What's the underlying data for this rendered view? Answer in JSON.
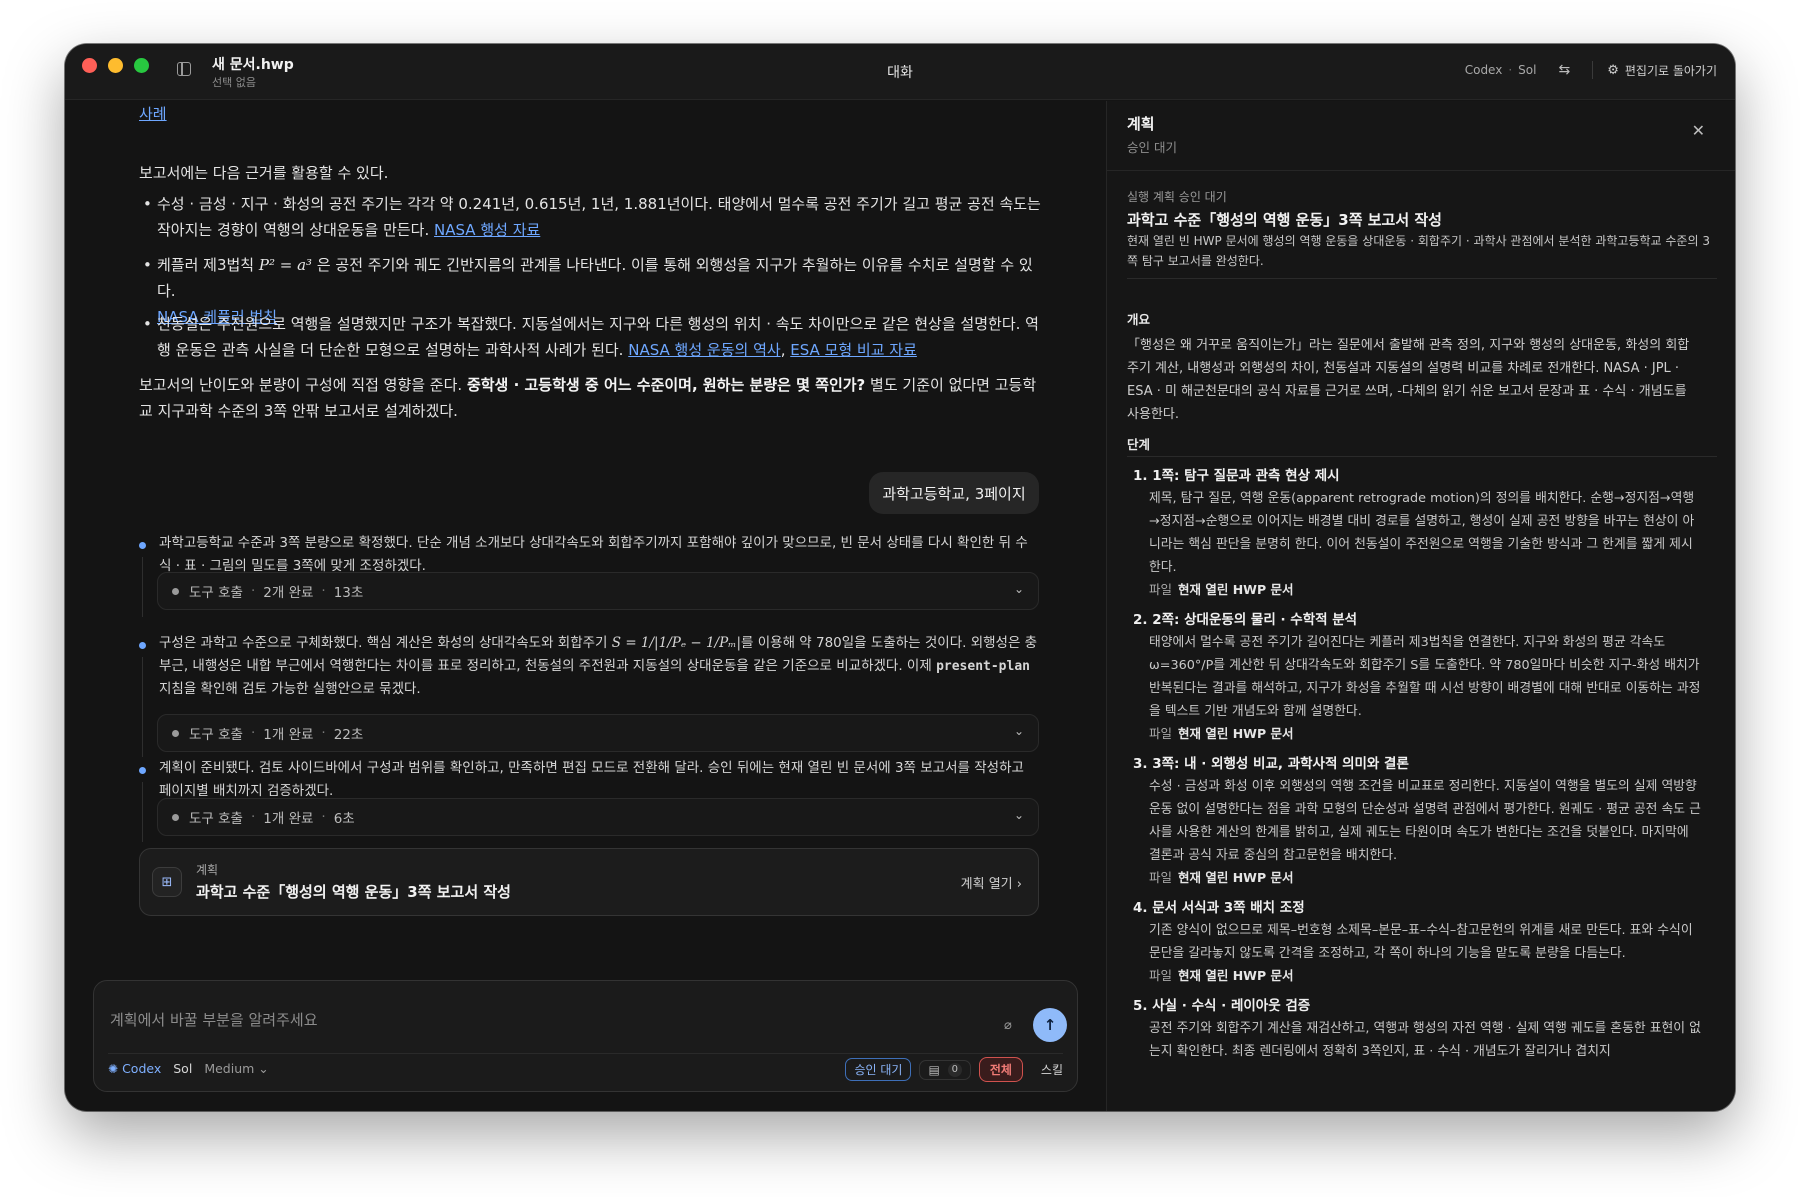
{
  "titlebar": {
    "doc_title": "새 문서.hwp",
    "doc_sub": "선택 없음",
    "center": "대화",
    "agent": "Codex",
    "model": "Sol",
    "back_label": "편집기로 돌아가기"
  },
  "chat": {
    "top_link": "사례",
    "intro": "보고서에는 다음 근거를 활용할 수 있다.",
    "bullets": {
      "b1_text": "수성 · 금성 · 지구 · 화성의 공전 주기는 각각 약 0.241년, 0.615년, 1년, 1.881년이다. 태양에서 멀수록 공전 주기가 길고 평균 공전 속도는 작아지는 경향이 역행의 상대운동을 만든다. ",
      "b1_link": "NASA 행성 자료",
      "b2_pre": "케플러 제3법칙 ",
      "b2_math": "P² = a³",
      "b2_post": " 은 공전 주기와 궤도 긴반지름의 관계를 나타낸다. 이를 통해 외행성을 지구가 추월하는 이유를 수치로 설명할 수 있다.",
      "b2_link": "NASA 케플러 법칙",
      "b3_text": "천동설은 주전원으로 역행을 설명했지만 구조가 복잡했다. 지동설에서는 지구와 다른 행성의 위치 · 속도 차이만으로 같은 현상을 설명한다. 역행 운동은 관측 사실을 더 단순한 모형으로 설명하는 과학사적 사례가 된다. ",
      "b3_link1": "NASA 행성 운동의 역사",
      "b3_sep": ", ",
      "b3_link2": "ESA 모형 비교 자료"
    },
    "closing_pre": "보고서의 난이도와 분량이 구성에 직접 영향을 준다. ",
    "closing_bold": "중학생 · 고등학생 중 어느 수준이며, 원하는 분량은 몇 쪽인가?",
    "closing_post": " 별도 기준이 없다면 고등학교 지구과학 수준의 3쪽 안팎 보고서로 설계하겠다.",
    "user_message": "과학고등학교, 3페이지",
    "steps": [
      {
        "text": "과학고등학교 수준과 3쪽 분량으로 확정했다. 단순 개념 소개보다 상대각속도와 회합주기까지 포함해야 깊이가 맞으므로, 빈 문서 상태를 다시 확인한 뒤 수식 · 표 · 그림의 밀도를 3쪽에 맞게 조정하겠다.",
        "tool": "도구 호출",
        "done": "2개 완료",
        "time": "13초"
      },
      {
        "text_pre": "구성은 과학고 수준으로 구체화했다. 핵심 계산은 화성의 상대각속도와 회합주기 ",
        "math": "S = 1/|1/Pₑ − 1/Pₘ|",
        "text_mid": "를 이용해 약 780일을 도출하는 것이다. 외행성은 충 부근, 내행성은 내합 부근에서 역행한다는 차이를 표로 정리하고, 천동설의 주전원과 지동설의 상대운동을 같은 기준으로 비교하겠다. 이제 ",
        "code": "present-plan",
        "text_post": " 지침을 확인해 검토 가능한 실행안으로 묶겠다.",
        "tool": "도구 호출",
        "done": "1개 완료",
        "time": "22초"
      },
      {
        "text": "계획이 준비됐다. 검토 사이드바에서 구성과 범위를 확인하고, 만족하면 편집 모드로 전환해 달라. 승인 뒤에는 현재 열린 빈 문서에 3쪽 보고서를 작성하고 페이지별 배치까지 검증하겠다.",
        "tool": "도구 호출",
        "done": "1개 완료",
        "time": "6초"
      }
    ],
    "plan_card": {
      "label": "계획",
      "title": "과학고 수준「행성의 역행 운동」3쪽 보고서 작성",
      "open": "계획 열기"
    }
  },
  "composer": {
    "placeholder": "계획에서 바꿀 부분을 알려주세요",
    "agent": "Codex",
    "model": "Sol",
    "effort": "Medium",
    "status_chip": "승인 대기",
    "count": "0",
    "scope": "전체",
    "skill": "스킬"
  },
  "panel": {
    "title": "계획",
    "subtitle": "승인 대기",
    "meta": "실행 계획  승인 대기",
    "plan_title": "과학고 수준「행성의 역행 운동」3쪽 보고서 작성",
    "plan_desc": "현재 열린 빈 HWP 문서에 행성의 역행 운동을 상대운동 · 회합주기 · 과학사 관점에서 분석한 과학고등학교 수준의 3쪽 탐구 보고서를 완성한다.",
    "overview_label": "개요",
    "overview": "「행성은 왜 거꾸로 움직이는가」라는 질문에서 출발해 관측 정의, 지구와 행성의 상대운동, 화성의 회합주기 계산, 내행성과 외행성의 차이, 천동설과 지동설의 설명력 비교를 차례로 전개한다. NASA · JPL · ESA · 미 해군천문대의 공식 자료를 근거로 쓰며, -다체의 읽기 쉬운 보고서 문장과 표 · 수식 · 개념도를 사용한다.",
    "steps_label": "단계",
    "file_label": "파일",
    "file_value": "현재 열린 HWP 문서",
    "steps": [
      {
        "title": "1. 1쪽: 탐구 질문과 관측 현상 제시",
        "body": "제목, 탐구 질문, 역행 운동(apparent retrograde motion)의 정의를 배치한다. 순행→정지점→역행→정지점→순행으로 이어지는 배경별 대비 경로를 설명하고, 행성이 실제 공전 방향을 바꾸는 현상이 아니라는 핵심 판단을 분명히 한다. 이어 천동설이 주전원으로 역행을 기술한 방식과 그 한계를 짧게 제시한다."
      },
      {
        "title": "2. 2쪽: 상대운동의 물리 · 수학적 분석",
        "body": "태양에서 멀수록 공전 주기가 길어진다는 케플러 제3법칙을 연결한다. 지구와 화성의 평균 각속도 ω=360°/P를 계산한 뒤 상대각속도와 회합주기 S를 도출한다. 약 780일마다 비슷한 지구-화성 배치가 반복된다는 결과를 해석하고, 지구가 화성을 추월할 때 시선 방향이 배경별에 대해 반대로 이동하는 과정을 텍스트 기반 개념도와 함께 설명한다."
      },
      {
        "title": "3. 3쪽: 내 · 외행성 비교, 과학사적 의미와 결론",
        "body": "수성 · 금성과 화성 이후 외행성의 역행 조건을 비교표로 정리한다. 지동설이 역행을 별도의 실제 역방향 운동 없이 설명한다는 점을 과학 모형의 단순성과 설명력 관점에서 평가한다. 원궤도 · 평균 공전 속도 근사를 사용한 계산의 한계를 밝히고, 실제 궤도는 타원이며 속도가 변한다는 조건을 덧붙인다. 마지막에 결론과 공식 자료 중심의 참고문헌을 배치한다."
      },
      {
        "title": "4. 문서 서식과 3쪽 배치 조정",
        "body": "기존 양식이 없으므로 제목–번호형 소제목–본문–표–수식–참고문헌의 위계를 새로 만든다. 표와 수식이 문단을 갈라놓지 않도록 간격을 조정하고, 각 쪽이 하나의 기능을 맡도록 분량을 다듬는다."
      },
      {
        "title": "5. 사실 · 수식 · 레이아웃 검증",
        "body": "공전 주기와 회합주기 계산을 재검산하고, 역행과 행성의 자전 역행 · 실제 역행 궤도를 혼동한 표현이 없는지 확인한다. 최종 렌더링에서 정확히 3쪽인지, 표 · 수식 · 개념도가 잘리거나 겹치지"
      }
    ]
  }
}
